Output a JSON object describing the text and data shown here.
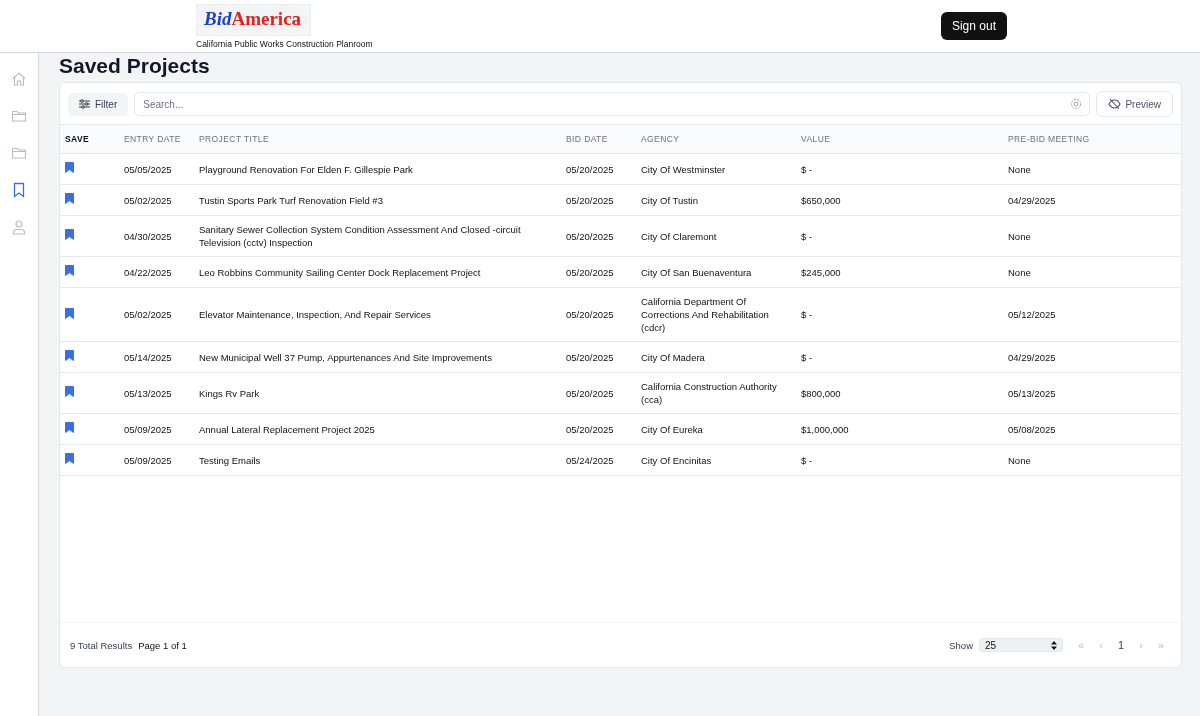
{
  "header": {
    "logo": {
      "part_1": "Bid",
      "part_2": "America"
    },
    "tagline": "California Public Works Construction Planroom",
    "sign_out": "Sign out"
  },
  "sidebar": {
    "items": [
      {
        "kind": "home",
        "selected": false
      },
      {
        "kind": "folder",
        "selected": false
      },
      {
        "kind": "folder",
        "selected": false
      },
      {
        "kind": "bookmark",
        "selected": true
      },
      {
        "kind": "user",
        "selected": false
      }
    ]
  },
  "page_title": "Saved Projects",
  "toolbar": {
    "filter": "Filter",
    "search": {
      "placeholder": "Search..."
    },
    "preview": "Preview"
  },
  "table": {
    "columns": [
      "SAVE",
      "ENTRY DATE",
      "PROJECT TITLE",
      "BID DATE",
      "AGENCY",
      "VALUE",
      "PRE-BID MEETING"
    ],
    "rows": [
      {
        "saved": true,
        "entry_date": "05/05/2025",
        "title": "Playground Renovation For Elden F. Gillespie Park",
        "bid_date": "05/20/2025",
        "agency": "City Of Westminster",
        "value": "$ -",
        "pre_bid": "None"
      },
      {
        "saved": true,
        "entry_date": "05/02/2025",
        "title": "Tustin Sports Park Turf Renovation Field #3",
        "bid_date": "05/20/2025",
        "agency": "City Of Tustin",
        "value": "$650,000",
        "pre_bid": "04/29/2025"
      },
      {
        "saved": true,
        "entry_date": "04/30/2025",
        "title": "Sanitary Sewer Collection System Condition Assessment And Closed -circuit Television (cctv) Inspection",
        "bid_date": "05/20/2025",
        "agency": "City Of Claremont",
        "value": "$ -",
        "pre_bid": "None"
      },
      {
        "saved": true,
        "entry_date": "04/22/2025",
        "title": "Leo Robbins Community Sailing Center Dock Replacement Project",
        "bid_date": "05/20/2025",
        "agency": "City Of San Buenaventura",
        "value": "$245,000",
        "pre_bid": "None"
      },
      {
        "saved": true,
        "entry_date": "05/02/2025",
        "title": "Elevator Maintenance, Inspection, And Repair Services",
        "bid_date": "05/20/2025",
        "agency": "California Department Of Corrections And Rehabilitation (cdcr)",
        "value": "$ -",
        "pre_bid": "05/12/2025"
      },
      {
        "saved": true,
        "entry_date": "05/14/2025",
        "title": "New Municipal Well 37 Pump, Appurtenances And Site Improvements",
        "bid_date": "05/20/2025",
        "agency": "City Of Madera",
        "value": "$ -",
        "pre_bid": "04/29/2025"
      },
      {
        "saved": true,
        "entry_date": "05/13/2025",
        "title": "Kings Rv Park",
        "bid_date": "05/20/2025",
        "agency": "California Construction Authority (cca)",
        "value": "$800,000",
        "pre_bid": "05/13/2025"
      },
      {
        "saved": true,
        "entry_date": "05/09/2025",
        "title": "Annual Lateral Replacement Project 2025",
        "bid_date": "05/20/2025",
        "agency": "City Of Eureka",
        "value": "$1,000,000",
        "pre_bid": "05/08/2025"
      },
      {
        "saved": true,
        "entry_date": "05/09/2025",
        "title": "Testing Emails",
        "bid_date": "05/24/2025",
        "agency": "City Of Encinitas",
        "value": "$ -",
        "pre_bid": "None"
      }
    ]
  },
  "footer": {
    "total": "9 Total Results",
    "page": "Page 1 of 1",
    "show_label": "Show",
    "page_size": "25",
    "pager": [
      {
        "label": "«",
        "kind": "nav"
      },
      {
        "label": "‹",
        "kind": "nav"
      },
      {
        "label": "1",
        "kind": "page"
      },
      {
        "label": "›",
        "kind": "nav"
      },
      {
        "label": "»",
        "kind": "nav"
      }
    ]
  }
}
